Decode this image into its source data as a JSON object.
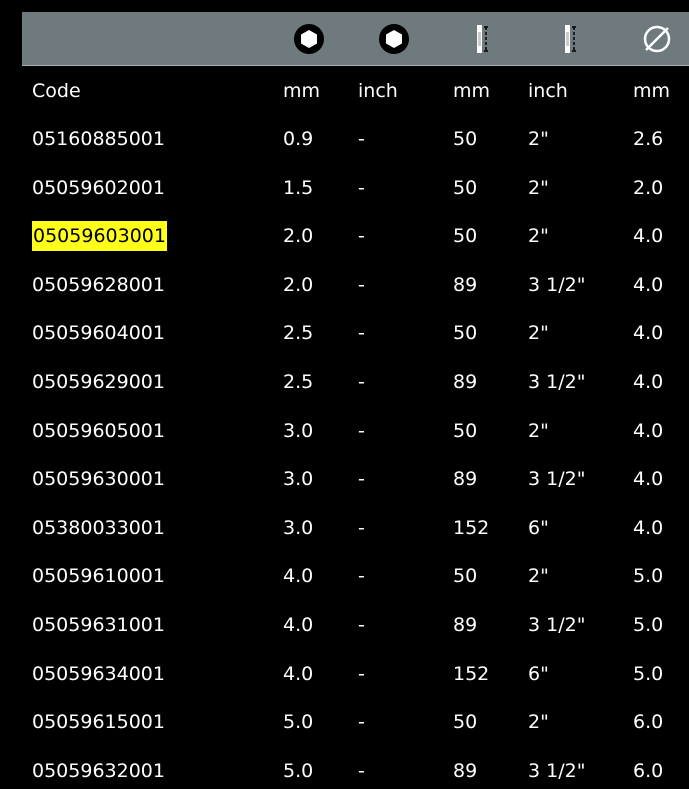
{
  "icons": [
    "hex-socket-icon",
    "hex-socket-icon",
    "bit-length-icon",
    "bit-length-icon",
    "diameter-icon"
  ],
  "headers": [
    "Code",
    "mm",
    "inch",
    "mm",
    "inch",
    "mm"
  ],
  "rows": [
    {
      "code": "05160885001",
      "size_mm": "0.9",
      "size_inch": "-",
      "length_mm": "50",
      "length_inch": "2\"",
      "diameter_mm": "2.6",
      "highlighted": false
    },
    {
      "code": "05059602001",
      "size_mm": "1.5",
      "size_inch": "-",
      "length_mm": "50",
      "length_inch": "2\"",
      "diameter_mm": "2.0",
      "highlighted": false
    },
    {
      "code": "05059603001",
      "size_mm": "2.0",
      "size_inch": "-",
      "length_mm": "50",
      "length_inch": "2\"",
      "diameter_mm": "4.0",
      "highlighted": true
    },
    {
      "code": "05059628001",
      "size_mm": "2.0",
      "size_inch": "-",
      "length_mm": "89",
      "length_inch": "3 1/2\"",
      "diameter_mm": "4.0",
      "highlighted": false
    },
    {
      "code": "05059604001",
      "size_mm": "2.5",
      "size_inch": "-",
      "length_mm": "50",
      "length_inch": "2\"",
      "diameter_mm": "4.0",
      "highlighted": false
    },
    {
      "code": "05059629001",
      "size_mm": "2.5",
      "size_inch": "-",
      "length_mm": "89",
      "length_inch": "3 1/2\"",
      "diameter_mm": "4.0",
      "highlighted": false
    },
    {
      "code": "05059605001",
      "size_mm": "3.0",
      "size_inch": "-",
      "length_mm": "50",
      "length_inch": "2\"",
      "diameter_mm": "4.0",
      "highlighted": false
    },
    {
      "code": "05059630001",
      "size_mm": "3.0",
      "size_inch": "-",
      "length_mm": "89",
      "length_inch": "3 1/2\"",
      "diameter_mm": "4.0",
      "highlighted": false
    },
    {
      "code": "05380033001",
      "size_mm": "3.0",
      "size_inch": "-",
      "length_mm": "152",
      "length_inch": "6\"",
      "diameter_mm": "4.0",
      "highlighted": false
    },
    {
      "code": "05059610001",
      "size_mm": "4.0",
      "size_inch": "-",
      "length_mm": "50",
      "length_inch": "2\"",
      "diameter_mm": "5.0",
      "highlighted": false
    },
    {
      "code": "05059631001",
      "size_mm": "4.0",
      "size_inch": "-",
      "length_mm": "89",
      "length_inch": "3 1/2\"",
      "diameter_mm": "5.0",
      "highlighted": false
    },
    {
      "code": "05059634001",
      "size_mm": "4.0",
      "size_inch": "-",
      "length_mm": "152",
      "length_inch": "6\"",
      "diameter_mm": "5.0",
      "highlighted": false
    },
    {
      "code": "05059615001",
      "size_mm": "5.0",
      "size_inch": "-",
      "length_mm": "50",
      "length_inch": "2\"",
      "diameter_mm": "6.0",
      "highlighted": false
    },
    {
      "code": "05059632001",
      "size_mm": "5.0",
      "size_inch": "-",
      "length_mm": "89",
      "length_inch": "3 1/2\"",
      "diameter_mm": "6.0",
      "highlighted": false
    }
  ],
  "highlight_color": "#ffff1a"
}
